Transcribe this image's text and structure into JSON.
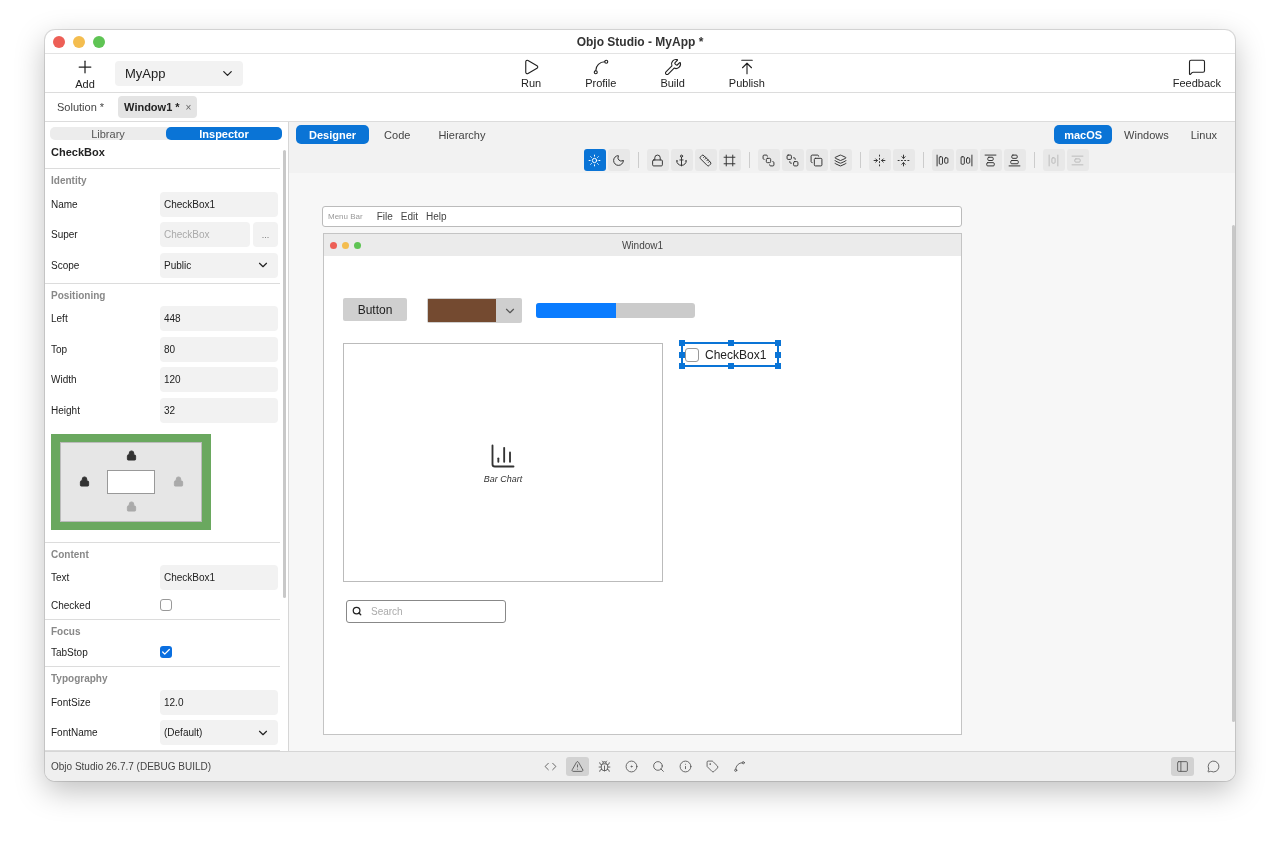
{
  "window": {
    "title": "Objo Studio - MyApp *"
  },
  "toolbar": {
    "add": "Add",
    "project": "MyApp",
    "actions": [
      {
        "label": "Run"
      },
      {
        "label": "Profile"
      },
      {
        "label": "Build"
      },
      {
        "label": "Publish"
      }
    ],
    "feedback": "Feedback"
  },
  "doc_tabs": [
    {
      "label": "Solution *",
      "selected": false
    },
    {
      "label": "Window1 *",
      "selected": true,
      "close": "×"
    }
  ],
  "sidebar": {
    "tabs": [
      {
        "label": "Library",
        "selected": false
      },
      {
        "label": "Inspector",
        "selected": true
      }
    ],
    "title": "CheckBox",
    "sections": [
      {
        "title": "Identity",
        "rows": [
          {
            "kind": "field",
            "label": "Name",
            "value": "CheckBox1"
          },
          {
            "kind": "picker",
            "label": "Super",
            "value": "CheckBox",
            "button": "...",
            "disabled": true
          },
          {
            "kind": "select",
            "label": "Scope",
            "value": "Public"
          }
        ]
      },
      {
        "title": "Positioning",
        "rows": [
          {
            "kind": "field",
            "label": "Left",
            "value": "448"
          },
          {
            "kind": "field",
            "label": "Top",
            "value": "80"
          },
          {
            "kind": "field",
            "label": "Width",
            "value": "120"
          },
          {
            "kind": "field",
            "label": "Height",
            "value": "32"
          }
        ],
        "anchors": {
          "top": true,
          "left": true,
          "right": false,
          "bottom": false
        }
      },
      {
        "title": "Content",
        "rows": [
          {
            "kind": "field",
            "label": "Text",
            "value": "CheckBox1"
          },
          {
            "kind": "checkbox",
            "label": "Checked",
            "checked": false
          }
        ]
      },
      {
        "title": "Focus",
        "rows": [
          {
            "kind": "checkbox",
            "label": "TabStop",
            "checked": true
          }
        ]
      },
      {
        "title": "Typography",
        "rows": [
          {
            "kind": "field",
            "label": "FontSize",
            "value": "12.0"
          },
          {
            "kind": "select",
            "label": "FontName",
            "value": "(Default)"
          }
        ]
      }
    ]
  },
  "designer": {
    "tabs": [
      {
        "label": "Designer",
        "selected": true
      },
      {
        "label": "Code",
        "selected": false
      },
      {
        "label": "Hierarchy",
        "selected": false
      }
    ],
    "platforms": [
      {
        "label": "macOS",
        "selected": true
      },
      {
        "label": "Windows",
        "selected": false
      },
      {
        "label": "Linux",
        "selected": false
      }
    ],
    "tool_groups": [
      [
        {
          "selected": true,
          "disabled": false
        },
        {
          "selected": false,
          "disabled": false
        }
      ],
      [
        {
          "selected": false,
          "disabled": false
        },
        {
          "selected": false,
          "disabled": false
        },
        {
          "selected": false,
          "disabled": false
        },
        {
          "selected": false,
          "disabled": false
        }
      ],
      [
        {
          "selected": false,
          "disabled": false
        },
        {
          "selected": false,
          "disabled": false
        },
        {
          "selected": false,
          "disabled": false
        },
        {
          "selected": false,
          "disabled": false
        }
      ],
      [
        {
          "selected": false,
          "disabled": false
        },
        {
          "selected": false,
          "disabled": false
        }
      ],
      [
        {
          "selected": false,
          "disabled": false
        },
        {
          "selected": false,
          "disabled": false
        },
        {
          "selected": false,
          "disabled": false
        },
        {
          "selected": false,
          "disabled": false
        }
      ],
      [
        {
          "selected": false,
          "disabled": true
        },
        {
          "selected": false,
          "disabled": true
        }
      ]
    ],
    "menu_bar": {
      "label": "Menu Bar",
      "menus": [
        "File",
        "Edit",
        "Help"
      ]
    },
    "mock_window": {
      "title": "Window1",
      "controls": [
        {
          "kind": "button",
          "text": "Button"
        },
        {
          "kind": "color",
          "color": "#744a30"
        },
        {
          "kind": "progress",
          "level": 0.5
        },
        {
          "kind": "chart",
          "text": "Bar Chart"
        },
        {
          "kind": "checkbox",
          "text": "CheckBox1",
          "checked": false,
          "selected": true
        },
        {
          "kind": "search",
          "placeholder": "Search"
        }
      ]
    }
  },
  "status_bar": {
    "text": "Objo Studio 26.7.7 (DEBUG BUILD)",
    "tools": [
      {
        "selected": false
      },
      {
        "selected": true
      },
      {
        "selected": false
      },
      {
        "selected": false
      },
      {
        "selected": false
      },
      {
        "selected": false
      },
      {
        "selected": false
      },
      {
        "selected": false
      }
    ],
    "right_tools": [
      {
        "selected": true
      },
      {
        "selected": false
      }
    ]
  }
}
